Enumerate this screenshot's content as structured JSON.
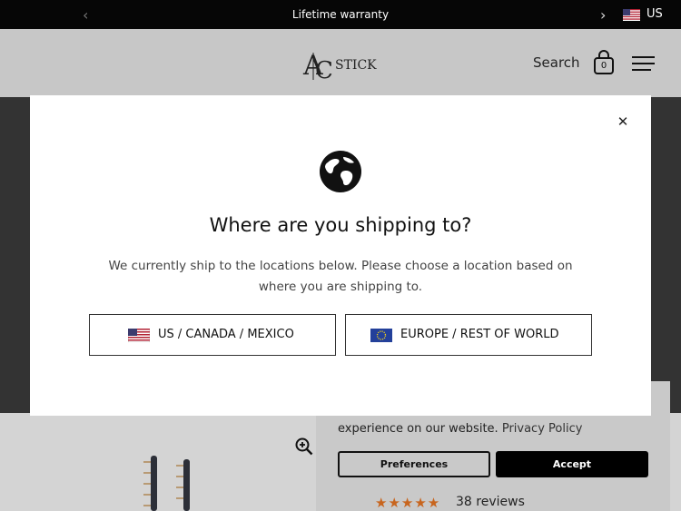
{
  "announcement": {
    "prev_icon": "chevron-left-icon",
    "message": "Lifetime warranty",
    "next_icon": "chevron-right-icon",
    "country_code": "US"
  },
  "header": {
    "logo_text": "STICK",
    "search_label": "Search",
    "cart_count": "0",
    "menu_icon": "hamburger-menu-icon"
  },
  "modal": {
    "title": "Where are you shipping to?",
    "description": "We currently ship to the locations below. Please choose a location based on where you are shipping to.",
    "close_icon": "close-icon",
    "options": [
      {
        "label": "US / CANADA / MEXICO",
        "flag": "us-flag-icon"
      },
      {
        "label": "EUROPE / REST OF WORLD",
        "flag": "eu-flag-icon"
      }
    ]
  },
  "cookie": {
    "text": "experience on our website.",
    "policy_link": "Privacy Policy",
    "preferences_label": "Preferences",
    "accept_label": "Accept"
  },
  "product": {
    "rating_stars": 5,
    "reviews": "38 reviews"
  },
  "colors": {
    "announcement_bg": "#060606",
    "modal_bg": "#ffffff",
    "star_color": "#c8651e"
  }
}
